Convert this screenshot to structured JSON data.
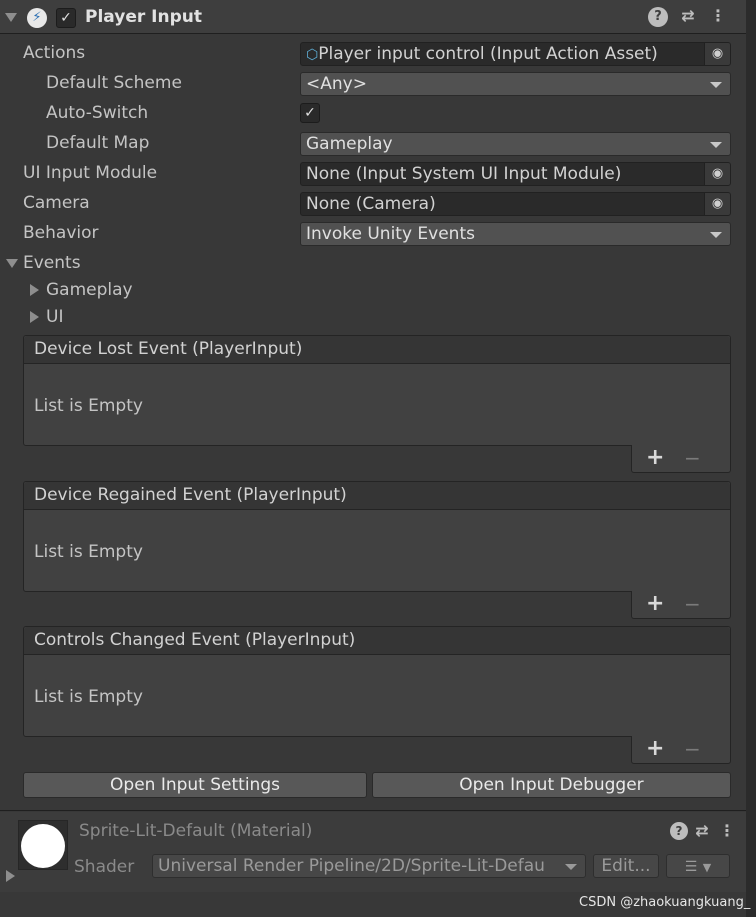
{
  "component": {
    "title": "Player Input",
    "icon": "lightning-icon",
    "enabled_check": "✓"
  },
  "fields": {
    "actions": {
      "label": "Actions",
      "value": "Player input control (Input Action Asset)"
    },
    "default_scheme": {
      "label": "Default Scheme",
      "value": "<Any>"
    },
    "auto_switch": {
      "label": "Auto-Switch",
      "checked": "✓"
    },
    "default_map": {
      "label": "Default Map",
      "value": "Gameplay"
    },
    "ui_input_module": {
      "label": "UI Input Module",
      "value": "None (Input System UI Input Module)"
    },
    "camera": {
      "label": "Camera",
      "value": "None (Camera)"
    },
    "behavior": {
      "label": "Behavior",
      "value": "Invoke Unity Events"
    }
  },
  "events": {
    "label": "Events",
    "groups": [
      "Gameplay",
      "UI"
    ],
    "boxes": [
      {
        "title": "Device Lost Event (PlayerInput)",
        "empty": "List is Empty"
      },
      {
        "title": "Device Regained Event (PlayerInput)",
        "empty": "List is Empty"
      },
      {
        "title": "Controls Changed Event (PlayerInput)",
        "empty": "List is Empty"
      }
    ],
    "plus": "+",
    "minus": "−"
  },
  "buttons": {
    "open_settings": "Open Input Settings",
    "open_debugger": "Open Input Debugger"
  },
  "material": {
    "title": "Sprite-Lit-Default (Material)",
    "shader_label": "Shader",
    "shader_value": "Universal Render Pipeline/2D/Sprite-Lit-Defau",
    "edit_label": "Edit..."
  },
  "watermark": "CSDN @zhaokuangkuang_",
  "colors": {
    "background": "#383838",
    "field": "#2a2a2a",
    "dropdown": "#515151",
    "button": "#585858"
  }
}
